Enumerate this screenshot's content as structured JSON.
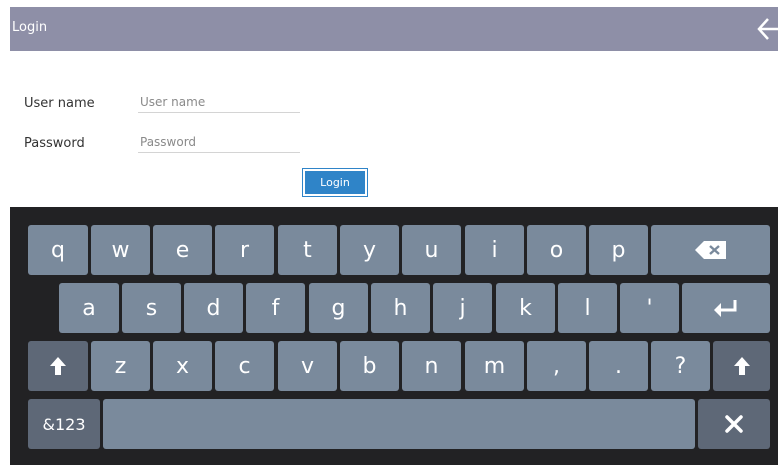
{
  "window": {
    "title": "Login",
    "back_icon": "back-arrow-icon"
  },
  "form": {
    "username_label": "User name",
    "username_placeholder": "User name",
    "username_value": "",
    "password_label": "Password",
    "password_placeholder": "Password",
    "password_value": "",
    "login_button": "Login",
    "accent_color": "#2f84c8"
  },
  "keyboard": {
    "row1": [
      "q",
      "w",
      "e",
      "r",
      "t",
      "y",
      "u",
      "i",
      "o",
      "p"
    ],
    "row2": [
      "a",
      "s",
      "d",
      "f",
      "g",
      "h",
      "j",
      "k",
      "l",
      "'"
    ],
    "row3": [
      "z",
      "x",
      "c",
      "v",
      "b",
      "n",
      "m",
      ",",
      ".",
      "?"
    ],
    "symbols_key": "&123",
    "icons": {
      "backspace": "backspace-icon",
      "enter": "enter-icon",
      "shift": "shift-icon",
      "close": "close-icon"
    }
  }
}
